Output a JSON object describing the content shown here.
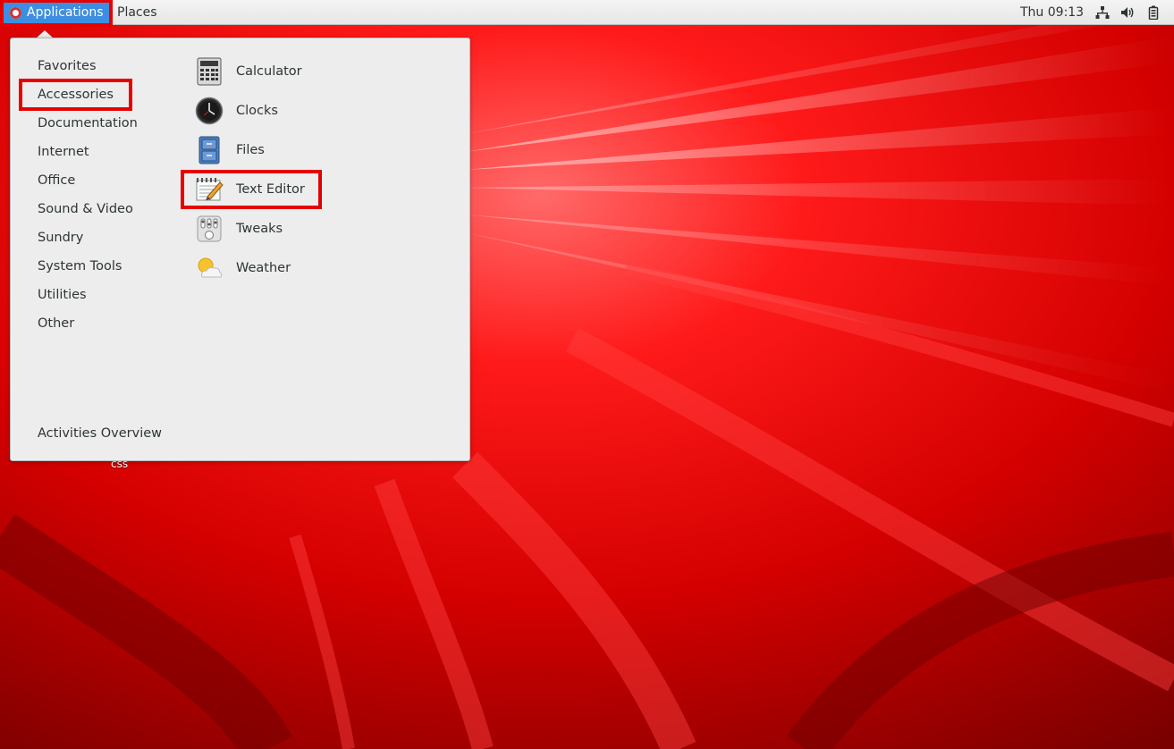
{
  "topbar": {
    "applications_label": "Applications",
    "places_label": "Places",
    "clock": "Thu 09:13",
    "tray_icons": [
      "network-icon",
      "volume-icon",
      "battery-icon"
    ]
  },
  "menu": {
    "categories": [
      {
        "label": "Favorites"
      },
      {
        "label": "Accessories",
        "highlighted": true
      },
      {
        "label": "Documentation"
      },
      {
        "label": "Internet"
      },
      {
        "label": "Office"
      },
      {
        "label": "Sound & Video"
      },
      {
        "label": "Sundry"
      },
      {
        "label": "System Tools"
      },
      {
        "label": "Utilities"
      },
      {
        "label": "Other"
      }
    ],
    "apps": [
      {
        "label": "Calculator",
        "icon": "calculator-icon"
      },
      {
        "label": "Clocks",
        "icon": "clock-icon"
      },
      {
        "label": "Files",
        "icon": "file-cabinet-icon"
      },
      {
        "label": "Text Editor",
        "icon": "text-editor-icon",
        "highlighted": true
      },
      {
        "label": "Tweaks",
        "icon": "tweaks-icon"
      },
      {
        "label": "Weather",
        "icon": "weather-icon"
      }
    ],
    "activities_label": "Activities Overview"
  },
  "desktop": {
    "partial_label": "css"
  },
  "colors": {
    "wallpaper": "#c80000",
    "highlight_box": "#e60000",
    "selected_button": "#3d8ee0",
    "menu_bg": "#ededed"
  }
}
